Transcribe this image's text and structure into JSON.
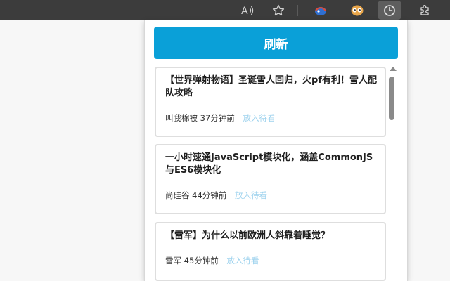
{
  "browser_toolbar": {
    "icons": [
      "read-aloud-icon",
      "favorite-star-icon",
      "extension-blue-icon",
      "extension-owl-icon",
      "clock-extension-icon",
      "extensions-puzzle-icon"
    ]
  },
  "popup": {
    "refresh_label": "刷新",
    "items": [
      {
        "title": "【世界弹射物语】圣诞雪人回归，火pf有利！雪人配队攻略",
        "author": "叫我棉被",
        "time": "37分钟前",
        "later_label": "放入待看"
      },
      {
        "title": "一小时速通JavaScript模块化，涵盖CommonJS与ES6模块化",
        "author": "尚硅谷",
        "time": "44分钟前",
        "later_label": "放入待看"
      },
      {
        "title": "【雷军】为什么以前欧洲人斜靠着睡觉？",
        "author": "雷军",
        "time": "45分钟前",
        "later_label": "放入待看"
      }
    ]
  },
  "colors": {
    "accent": "#0aa0d8",
    "later_link": "#9fd3ee",
    "toolbar_bg": "#3c3c3c"
  }
}
